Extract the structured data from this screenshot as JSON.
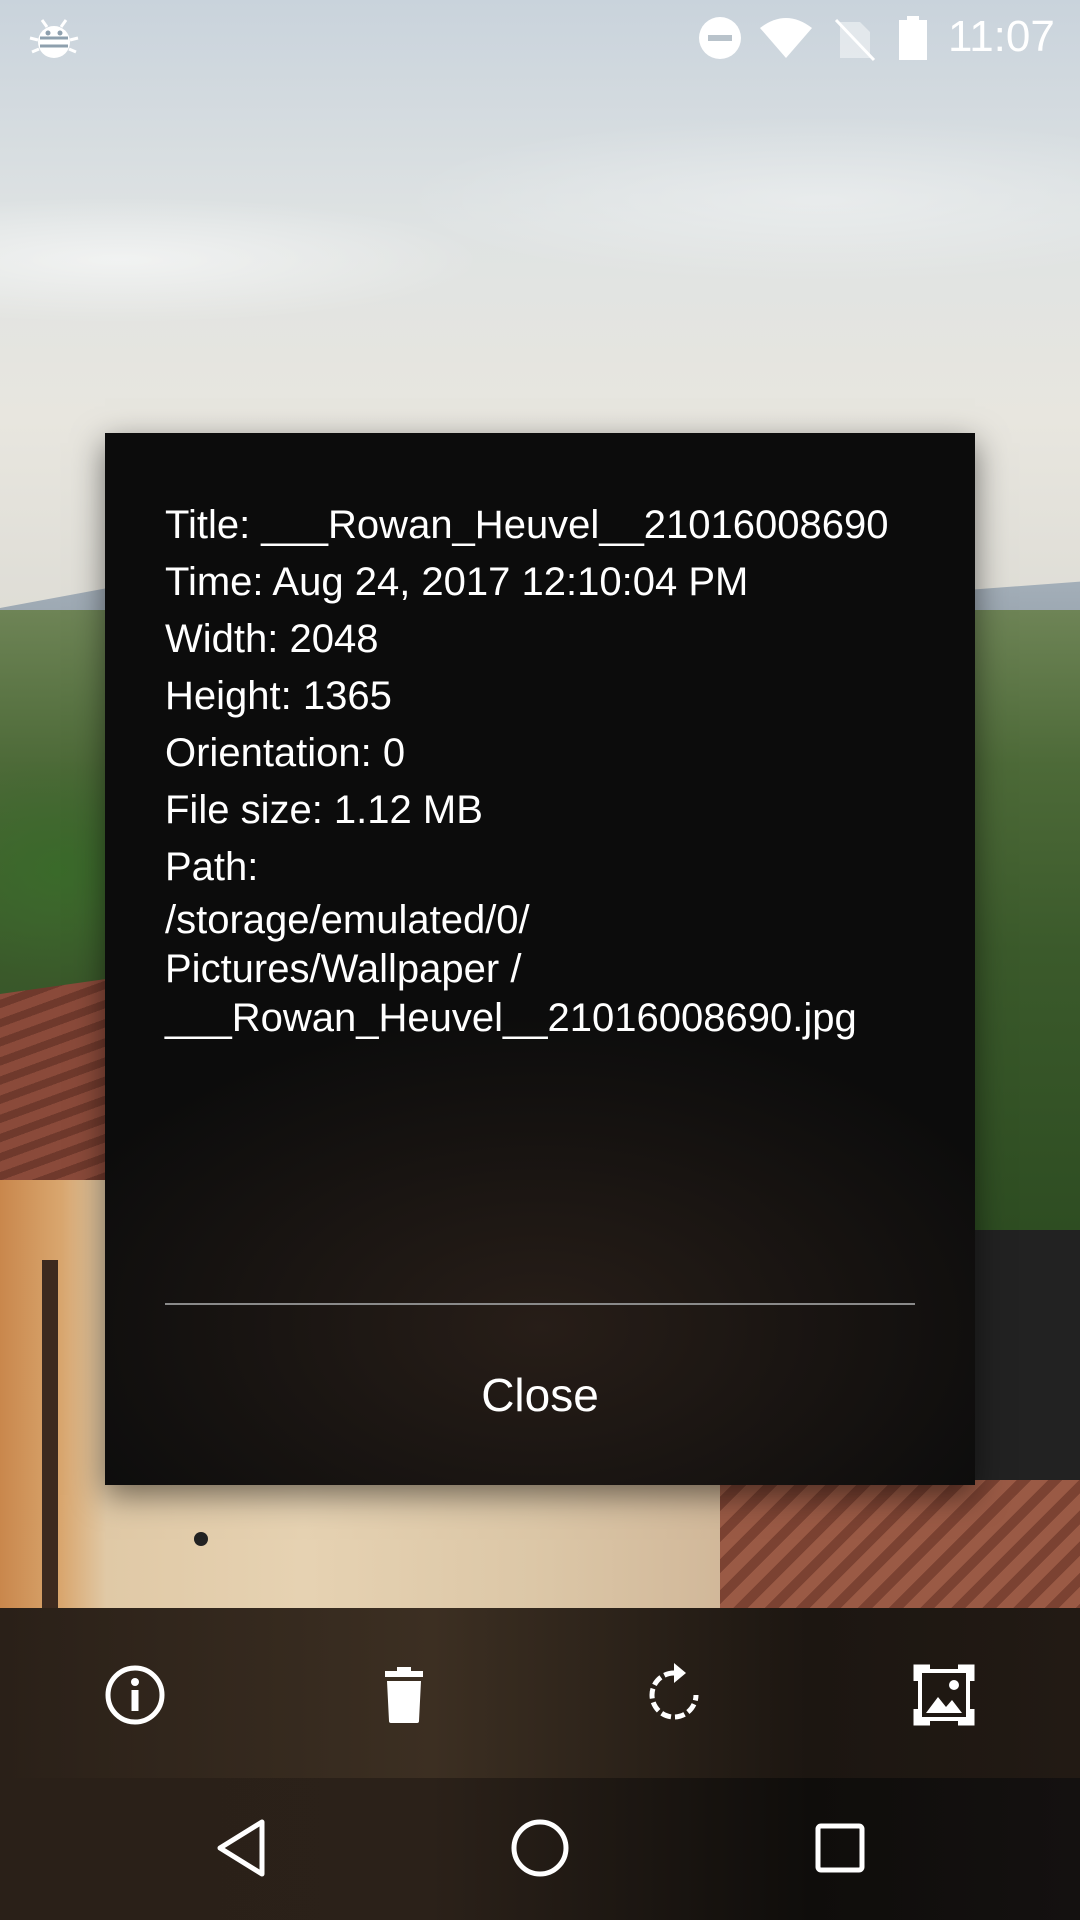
{
  "status_bar": {
    "time": "11:07",
    "icons": [
      "bug-icon",
      "do-not-disturb-icon",
      "wifi-icon",
      "no-sim-icon",
      "battery-icon"
    ]
  },
  "dialog": {
    "details": {
      "title_line": "Title: ___Rowan_Heuvel__21016008690",
      "time_line": "Time: Aug 24, 2017 12:10:04 PM",
      "width_line": "Width: 2048",
      "height_line": "Height: 1365",
      "orientation_line": "Orientation: 0",
      "file_size_line": "File size: 1.12 MB",
      "path_label": "Path:",
      "path_part1": "/storage/emulated/0/",
      "path_part2": "Pictures/Wallpaper /",
      "path_part3": "___Rowan_Heuvel__21016008690.jpg"
    },
    "close_label": "Close"
  },
  "action_bar": {
    "icons": [
      "info-icon",
      "delete-icon",
      "rotate-icon",
      "set-wallpaper-icon"
    ]
  },
  "nav_bar": {
    "icons": [
      "back-icon",
      "home-icon",
      "recents-icon"
    ]
  }
}
